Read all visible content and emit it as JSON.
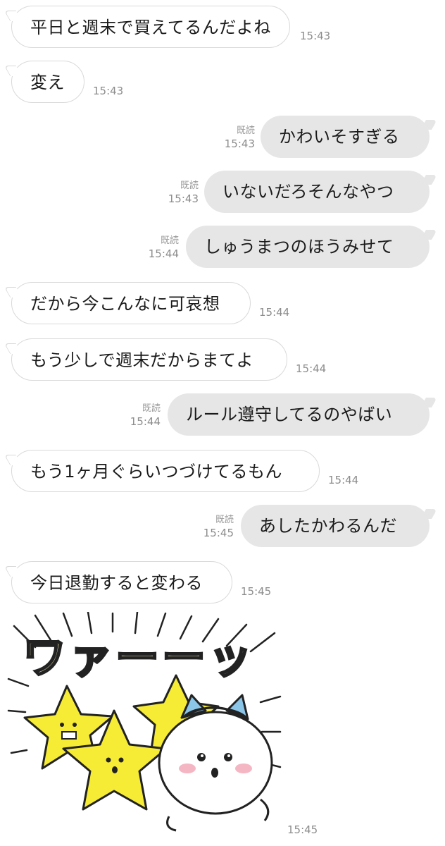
{
  "messages": [
    {
      "side": "in",
      "text": "平日と週末で買えてるんだよね",
      "time": "15:43"
    },
    {
      "side": "in",
      "text": "変え",
      "time": "15:43"
    },
    {
      "side": "out",
      "text": "かわいそすぎる",
      "time": "15:43",
      "read": "既読"
    },
    {
      "side": "out",
      "text": "いないだろそんなやつ",
      "time": "15:43",
      "read": "既読"
    },
    {
      "side": "out",
      "text": "しゅうまつのほうみせて",
      "time": "15:44",
      "read": "既読"
    },
    {
      "side": "in",
      "text": "だから今こんなに可哀想",
      "time": "15:44"
    },
    {
      "side": "in",
      "text": "もう少しで週末だからまてよ",
      "time": "15:44"
    },
    {
      "side": "out",
      "text": "ルール遵守してるのやばい",
      "time": "15:44",
      "read": "既読"
    },
    {
      "side": "in",
      "text": "もう1ヶ月ぐらいつづけてるもん",
      "time": "15:44"
    },
    {
      "side": "out",
      "text": "あしたかわるんだ",
      "time": "15:45",
      "read": "既読"
    },
    {
      "side": "in",
      "text": "今日退勤すると変わる",
      "time": "15:45"
    }
  ],
  "sticker": {
    "title_text": "ワァーーッ",
    "time": "15:45",
    "colors": {
      "star": "#f7ec35",
      "cat_ears": "#8bc5e8",
      "blush": "#f4b6c2"
    }
  }
}
